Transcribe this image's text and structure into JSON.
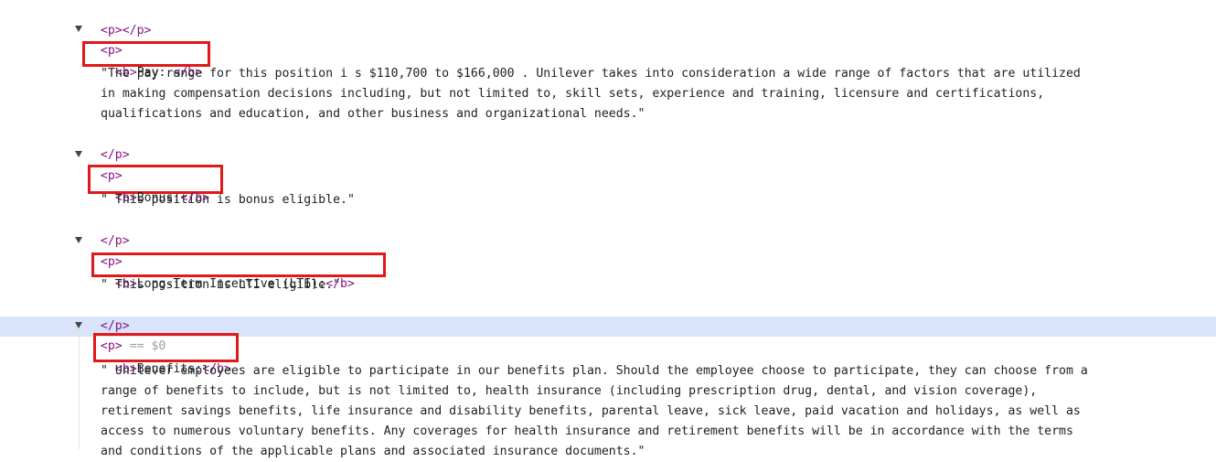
{
  "elements": {
    "empty_p_open": "<p>",
    "empty_p_close": "</p>",
    "p_open": "<p>",
    "p_close": "</p>",
    "b_open": "<b>",
    "b_close": "</b>",
    "selected_suffix": "== $0"
  },
  "sections": [
    {
      "label": "Pay: ",
      "text_lines": [
        "\"The pay range for this position i s $110,700 to $166,000 . Unilever takes into consideration a wide range of factors that are utilized",
        "in making compensation decisions including, but not limited to, skill sets, experience and training, licensure and certifications,",
        "qualifications and education, and other business and organizational needs.\""
      ]
    },
    {
      "label": "Bonus:",
      "text_lines": [
        "\" This position is bonus eligible.\""
      ]
    },
    {
      "label": "Long-Term Incentive (LTI):",
      "text_lines": [
        "\" This position is LTI eligible.\""
      ]
    },
    {
      "label": "Benefits:",
      "text_lines": [
        "\" Unilever employees are eligible to participate in our benefits plan. Should the employee choose to participate, they can choose from a",
        "range of benefits to include, but is not limited to, health insurance (including prescription drug, dental, and vision coverage),",
        "retirement savings benefits, life insurance and disability benefits, parental leave, sick leave, paid vacation and holidays, as well as",
        "access to numerous voluntary benefits. Any coverages for health insurance and retirement benefits will be in accordance with the terms",
        "and conditions of the applicable plans and associated insurance documents.\""
      ]
    }
  ]
}
